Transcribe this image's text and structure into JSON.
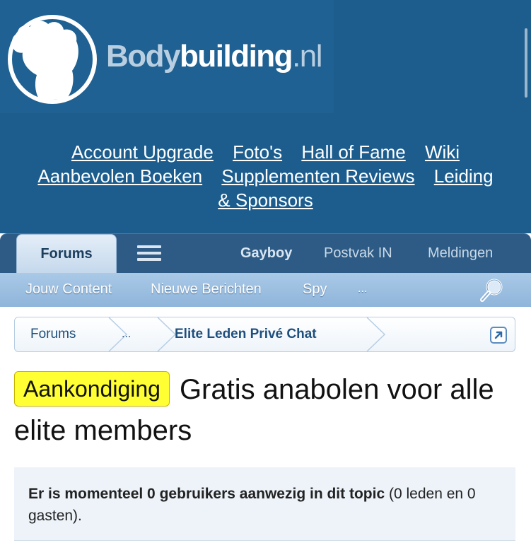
{
  "header": {
    "logo": {
      "prefix": "Body",
      "main": "building",
      "ext": ".nl"
    },
    "links": [
      {
        "label": "Account Upgrade"
      },
      {
        "label": "Foto's"
      },
      {
        "label": "Hall of Fame"
      },
      {
        "label": "Wiki"
      },
      {
        "label": "Aanbevolen Boeken"
      },
      {
        "label": "Supplementen Reviews"
      },
      {
        "label": "Leiding"
      },
      {
        "label": "& Sponsors"
      }
    ]
  },
  "nav": {
    "forums_tab": "Forums",
    "menu_icon": "hamburger-menu-icon",
    "user": "Gayboy",
    "inbox": "Postvak IN",
    "alerts": "Meldingen"
  },
  "subnav": {
    "items": [
      "Jouw Content",
      "Nieuwe Berichten",
      "Spy",
      "..."
    ],
    "search_icon": "search-icon"
  },
  "breadcrumb": {
    "items": [
      "Forums",
      "...",
      "Elite Leden Privé Chat"
    ],
    "jump_icon": "external-link-icon"
  },
  "thread": {
    "prefix": "Aankondiging",
    "title": "Gratis anabolen voor alle elite members"
  },
  "users_online": {
    "bold": "Er is momenteel 0 gebruikers aanwezig in dit topic",
    "rest": "(0 leden en 0 gasten)."
  },
  "colors": {
    "header_bg": "#1c5d8e",
    "nav_bg": "#2d5b85",
    "subnav_bg": "#9cbfe1",
    "prefix_badge": "#ffff33"
  }
}
